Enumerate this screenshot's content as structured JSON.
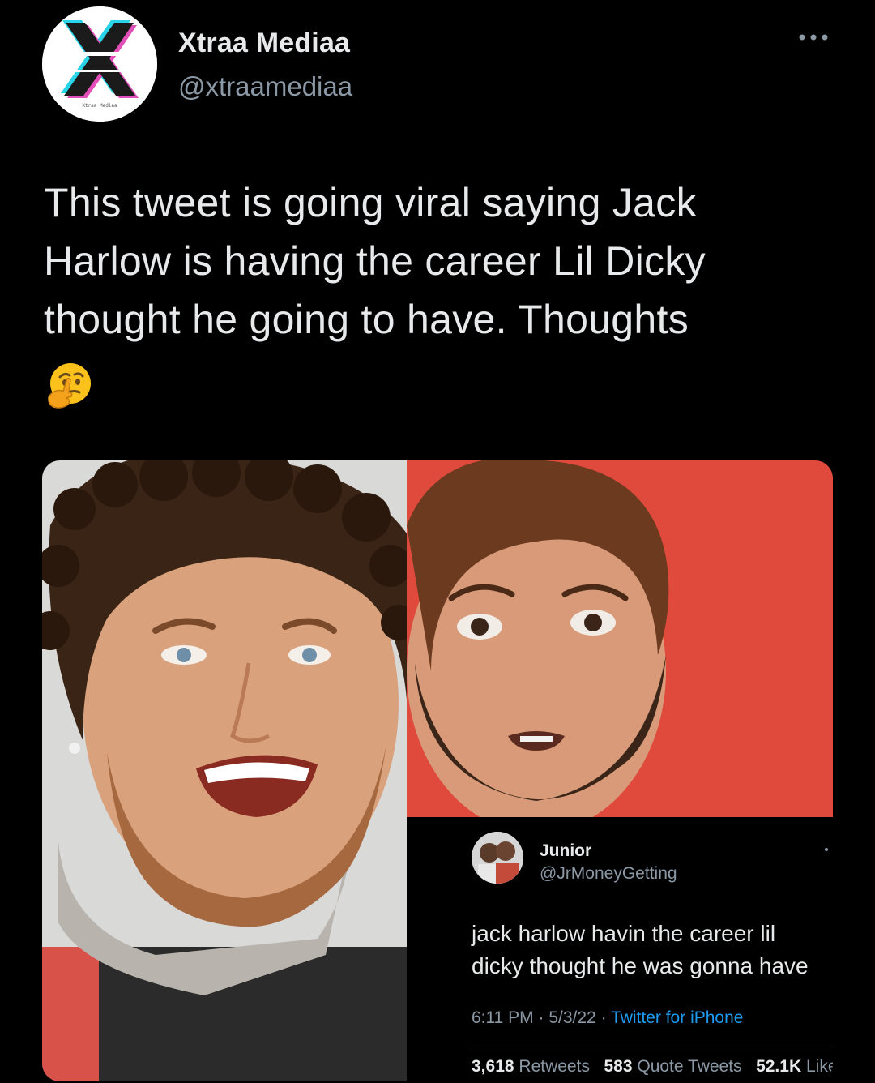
{
  "tweet": {
    "author_name": "Xtraa Mediaa",
    "author_handle": "@xtraamediaa",
    "avatar_text": "Xtraa Mediaa",
    "text": "This tweet is going viral saying Jack Harlow is having the career Lil Dicky thought he going to have. Thoughts",
    "emoji_icon": "thinking-face-icon",
    "more_icon": "more-options-icon"
  },
  "media": {
    "left_photo": "portrait-photo-curly-hair",
    "right_photo": "portrait-photo-red-background"
  },
  "embedded_tweet": {
    "name": "Junior",
    "handle": "@JrMoneyGetting",
    "text": "jack harlow havin the career lil dicky thought he was gonna have",
    "time": "6:11 PM",
    "date": "5/3/22",
    "source": "Twitter for iPhone",
    "separator": "·",
    "retweets_count": "3,618",
    "retweets_label": "Retweets",
    "quotes_count": "583",
    "quotes_label": "Quote Tweets",
    "likes_count": "52.1K",
    "likes_label": "Likes"
  },
  "colors": {
    "background": "#000000",
    "text": "#e7e9ea",
    "secondary_text": "#8b98a5",
    "link": "#1d9bf0",
    "photo_red": "#e0453a"
  }
}
